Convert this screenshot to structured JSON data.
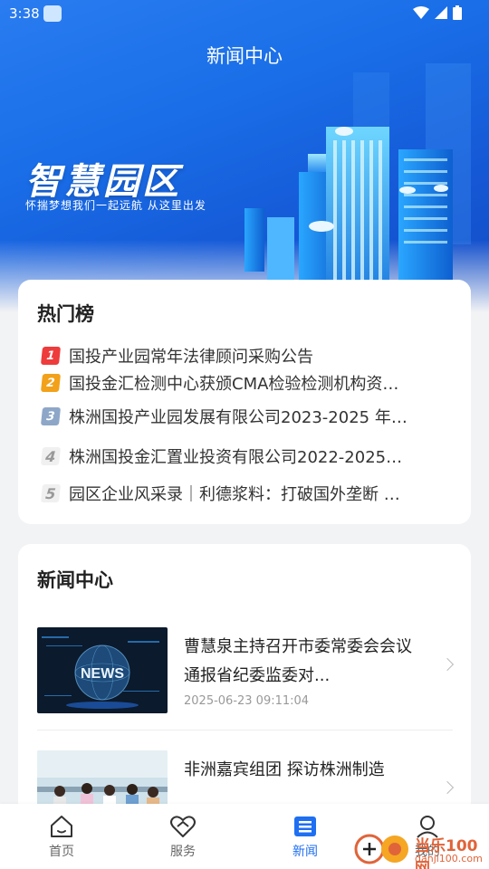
{
  "status_bar": {
    "time": "3:38"
  },
  "header": {
    "title": "新闻中心"
  },
  "banner": {
    "brand": "智慧园区",
    "slogan": "怀揣梦想我们一起远航  从这里出发"
  },
  "hot_list": {
    "title": "热门榜",
    "items": [
      {
        "rank": "1",
        "text": "国投产业园常年法律顾问采购公告"
      },
      {
        "rank": "2",
        "text": "国投金汇检测中心获颁CMA检验检测机构资…"
      },
      {
        "rank": "3",
        "text": "株洲国投产业园发展有限公司2023-2025 年…"
      },
      {
        "rank": "4",
        "text": "株洲国投金汇置业投资有限公司2022-2025…"
      },
      {
        "rank": "5",
        "text": "园区企业风采录｜利德浆料：打破国外垄断 …"
      }
    ]
  },
  "news": {
    "title": "新闻中心",
    "items": [
      {
        "headline": "曹慧泉主持召开市委常委会会议 通报省纪委监委对...",
        "time": "2025-06-23 09:11:04",
        "thumb_text": "NEWS"
      },
      {
        "headline": "非洲嘉宾组团 探访株洲制造",
        "time": ""
      }
    ]
  },
  "bottom_nav": {
    "items": [
      {
        "label": "首页",
        "icon": "home-icon"
      },
      {
        "label": "服务",
        "icon": "heart-icon"
      },
      {
        "label": "新闻",
        "icon": "news-icon"
      },
      {
        "label": "我的",
        "icon": "profile-icon"
      }
    ],
    "active": "新闻"
  },
  "watermark": {
    "text": "当乐100网",
    "url": "danji100.com"
  },
  "colors": {
    "primary": "#1f6ff2",
    "rank1": "#ee3b3b",
    "rank2": "#f2a11a",
    "rank3": "#8ea7c8"
  }
}
